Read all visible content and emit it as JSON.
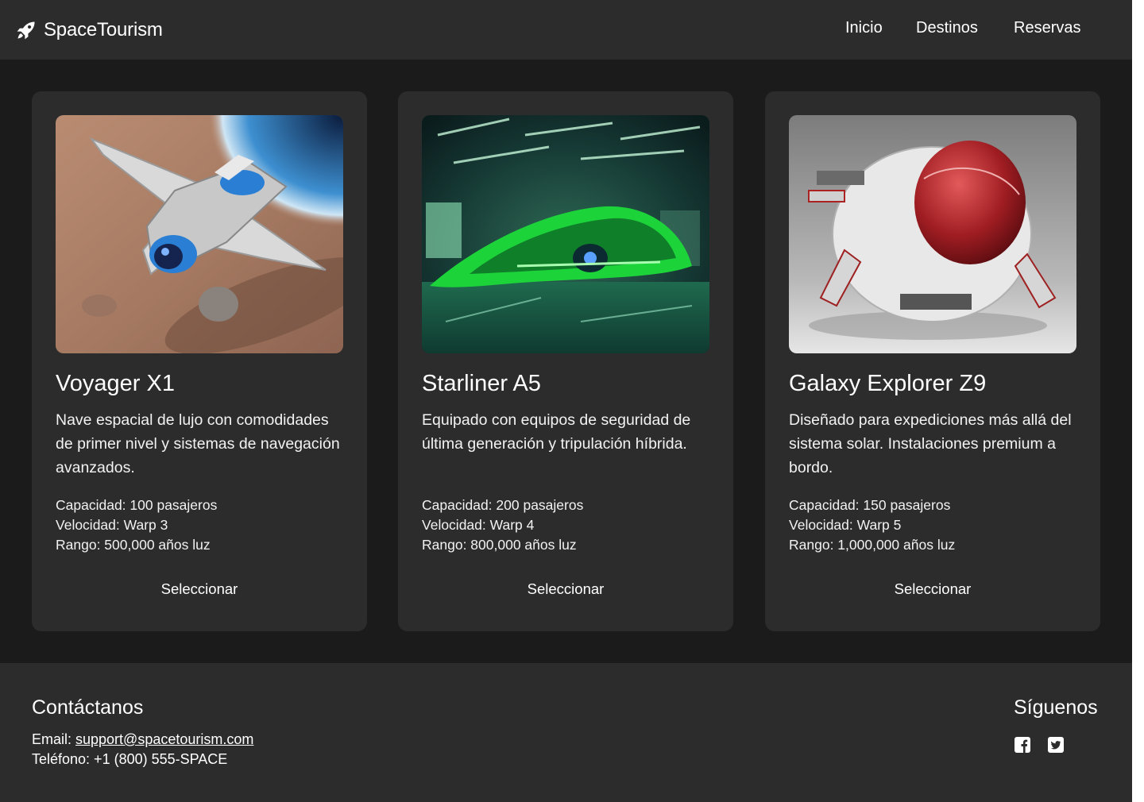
{
  "header": {
    "brand": "SpaceTourism",
    "brand_icon": "rocket-icon",
    "nav": [
      "Inicio",
      "Destinos",
      "Reservas"
    ]
  },
  "ships": [
    {
      "name": "Voyager X1",
      "description": "Nave espacial de lujo con comodidades de primer nivel y sistemas de navegación avanzados.",
      "capacity": "Capacidad: 100 pasajeros",
      "speed": "Velocidad: Warp 3",
      "range": "Rango: 500,000 años luz",
      "button": "Seleccionar"
    },
    {
      "name": "Starliner A5",
      "description": "Equipado con equipos de seguridad de última generación y tripulación híbrida.",
      "capacity": "Capacidad: 200 pasajeros",
      "speed": "Velocidad: Warp 4",
      "range": "Rango: 800,000 años luz",
      "button": "Seleccionar"
    },
    {
      "name": "Galaxy Explorer Z9",
      "description": "Diseñado para expediciones más allá del sistema solar. Instalaciones premium a bordo.",
      "capacity": "Capacidad: 150 pasajeros",
      "speed": "Velocidad: Warp 5",
      "range": "Rango: 1,000,000 años luz",
      "button": "Seleccionar"
    }
  ],
  "footer": {
    "contact_title": "Contáctanos",
    "email_label": "Email: ",
    "email": "support@spacetourism.com",
    "phone": "Teléfono: +1 (800) 555-SPACE",
    "social_title": "Síguenos",
    "social_icons": [
      "facebook-icon",
      "twitter-icon"
    ]
  },
  "colors": {
    "page_bg": "#1b1b1b",
    "panel_bg": "#2c2c2c",
    "text": "#ffffff"
  }
}
